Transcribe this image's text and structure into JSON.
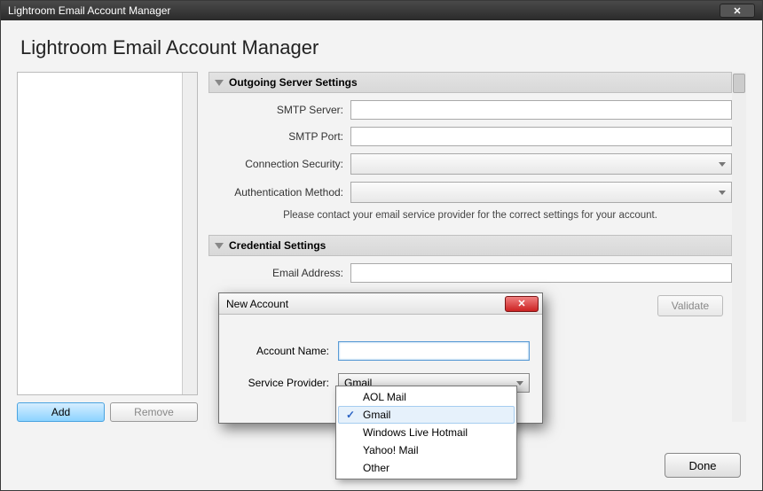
{
  "window": {
    "title": "Lightroom Email Account Manager"
  },
  "page": {
    "heading": "Lightroom Email Account Manager"
  },
  "left": {
    "add_label": "Add",
    "remove_label": "Remove"
  },
  "sections": {
    "outgoing": {
      "title": "Outgoing Server Settings",
      "smtp_server_label": "SMTP Server:",
      "smtp_server_value": "",
      "smtp_port_label": "SMTP Port:",
      "smtp_port_value": "",
      "security_label": "Connection Security:",
      "security_value": "",
      "auth_label": "Authentication Method:",
      "auth_value": "",
      "help": "Please contact your email service provider for the correct settings for your account."
    },
    "credentials": {
      "title": "Credential Settings",
      "email_label": "Email Address:",
      "email_value": ""
    }
  },
  "buttons": {
    "validate": "Validate",
    "done": "Done"
  },
  "modal": {
    "title": "New Account",
    "account_name_label": "Account Name:",
    "account_name_value": "",
    "provider_label": "Service Provider:",
    "provider_selected": "Gmail",
    "provider_options": [
      "AOL Mail",
      "Gmail",
      "Windows Live Hotmail",
      "Yahoo! Mail",
      "Other"
    ]
  }
}
